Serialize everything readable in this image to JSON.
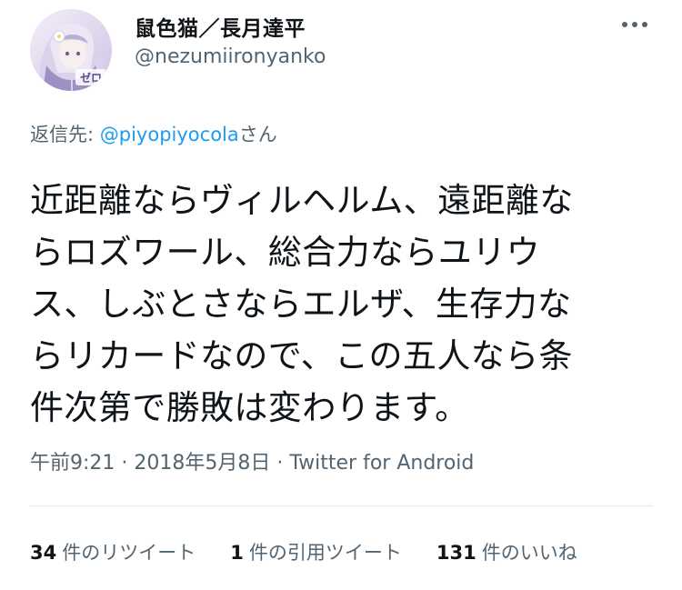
{
  "author": {
    "display_name": "鼠色猫／長月達平",
    "handle": "@nezumiironyanko",
    "avatar_badge": "ゼロ"
  },
  "reply": {
    "prefix": "返信先: ",
    "mention": "@piyopiyocola",
    "suffix": "さん"
  },
  "tweet": {
    "text": "近距離ならヴィルヘルム、遠距離な\nらロズワール、総合力ならユリウ\nス、しぶとさならエルザ、生存力な\nらリカードなので、この五人なら条\n件次第で勝敗は変わります。"
  },
  "meta": {
    "time": "午前9:21",
    "separator": " · ",
    "date": "2018年5月8日",
    "source": "Twitter for Android"
  },
  "stats": {
    "retweets": {
      "count": "34",
      "label": "件のリツイート"
    },
    "quotes": {
      "count": "1",
      "label": "件の引用ツイート"
    },
    "likes": {
      "count": "131",
      "label": "件のいいね"
    }
  },
  "icons": {
    "more": "more-horizontal-icon"
  },
  "colors": {
    "text": "#0f1419",
    "secondary": "#536471",
    "accent": "#1d9bf0",
    "divider": "#e1e8ed"
  }
}
